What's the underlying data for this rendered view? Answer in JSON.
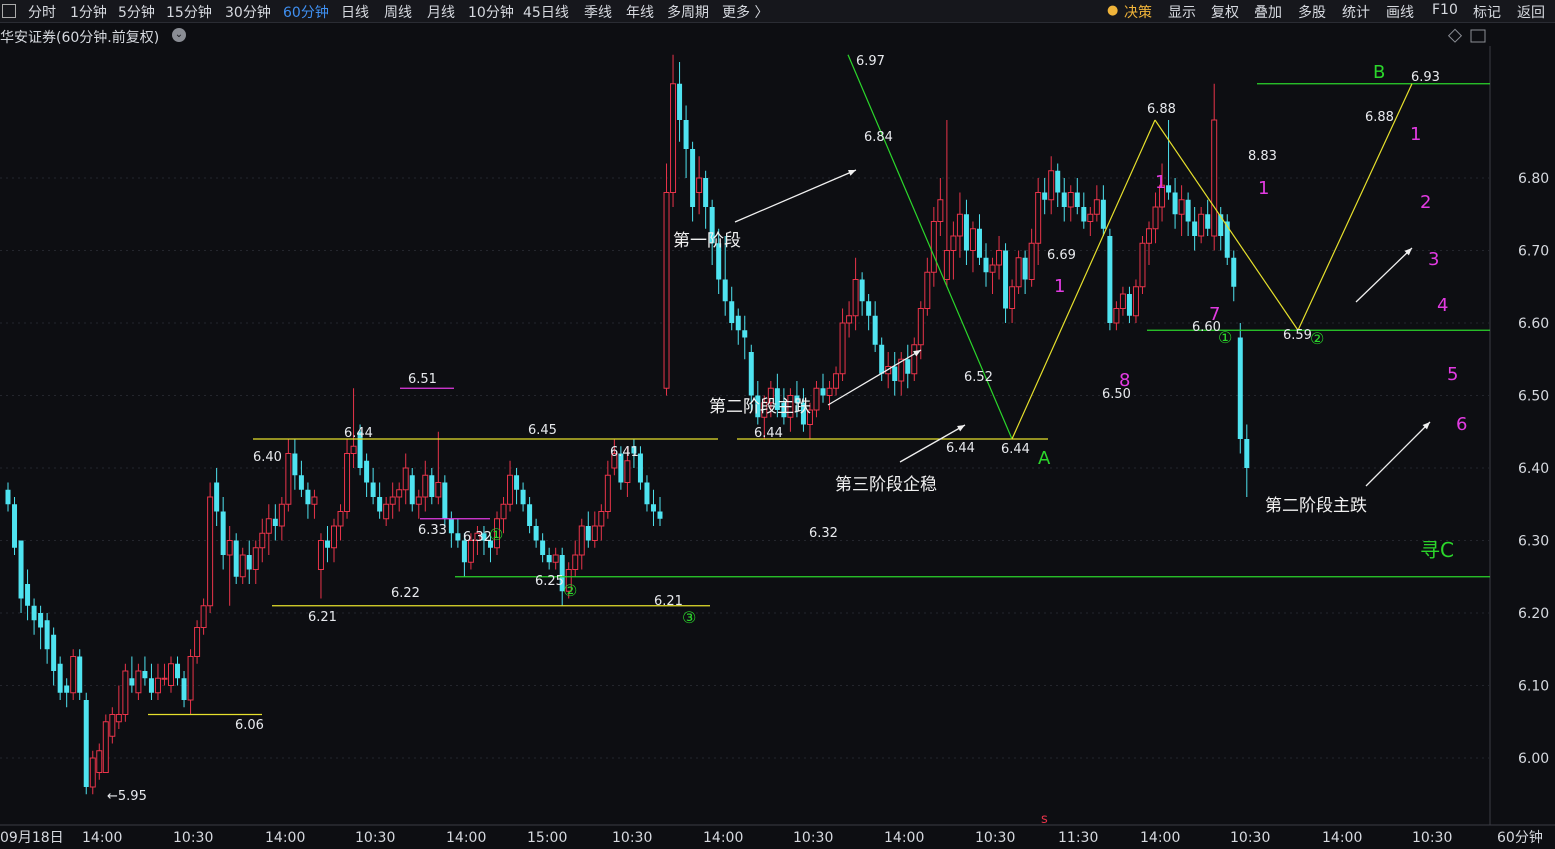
{
  "toolbar": {
    "periods": [
      "分时",
      "1分钟",
      "5分钟",
      "15分钟",
      "30分钟",
      "60分钟",
      "日线",
      "周线",
      "月线",
      "10分钟",
      "45日线",
      "季线",
      "年线",
      "多周期",
      "更多 〉"
    ],
    "active_period": "60分钟",
    "right": [
      "决策",
      "显示",
      "复权",
      "叠加",
      "多股",
      "统计",
      "画线",
      "F10",
      "标记",
      "返回"
    ]
  },
  "title": "华安证券(60分钟.前复权)",
  "period_label": "60分钟",
  "chart_data": {
    "type": "candlestick",
    "symbol": "华安证券",
    "interval": "60分钟",
    "adjust": "前复权",
    "y_ticks": [
      6.0,
      6.1,
      6.2,
      6.3,
      6.4,
      6.5,
      6.6,
      6.7,
      6.8
    ],
    "ylim": [
      5.93,
      7.01
    ],
    "x_labels": [
      "09月18日",
      "14:00",
      "10:30",
      "14:00",
      "10:30",
      "14:00",
      "15:00",
      "10:30",
      "14:00",
      "10:30",
      "14:00",
      "10:30",
      "11:30",
      "14:00",
      "10:30",
      "14:00",
      "10:30"
    ],
    "price_labels": [
      "5.95",
      "6.06",
      "6.40",
      "6.21",
      "6.44",
      "6.22",
      "6.51",
      "6.33",
      "6.32",
      "6.45",
      "6.25",
      "6.41",
      "6.21",
      "6.44",
      "6.32",
      "6.97",
      "6.84",
      "6.52",
      "6.44",
      "6.44",
      "6.69",
      "6.50",
      "6.88",
      "6.60",
      "8.83",
      "6.59",
      "6.88",
      "6.93"
    ],
    "annotations": [
      "第一阶段",
      "第二阶段主跌",
      "第三阶段企稳",
      "第二阶段主跌"
    ],
    "wave_labels": [
      "A",
      "B",
      "寻C"
    ],
    "count_labels": [
      "1",
      "2",
      "3",
      "4",
      "5",
      "6",
      "1",
      "7",
      "8",
      "1",
      "1"
    ],
    "circled_labels": [
      "①",
      "②",
      "③",
      "①",
      "①",
      "②"
    ],
    "marker": "s",
    "colors": {
      "up": "#e8344a",
      "down": "#4fe3f0",
      "yellow": "#e6e02c",
      "green": "#2bd62b",
      "magenta": "#e23be2",
      "bg": "#0d0e12"
    }
  }
}
